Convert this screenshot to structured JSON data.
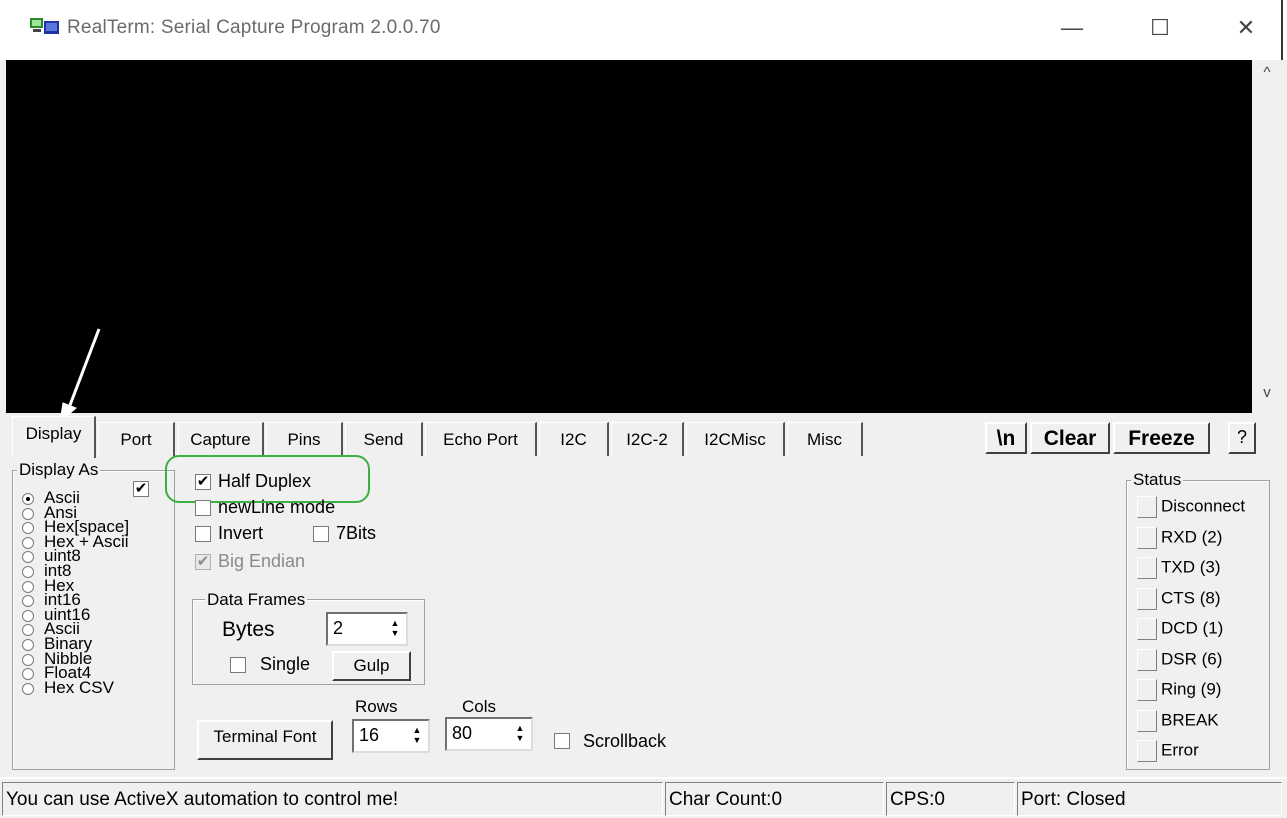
{
  "window": {
    "title": "RealTerm: Serial Capture Program 2.0.0.70",
    "minimize_glyph": "—",
    "maximize_glyph": "☐",
    "close_glyph": "✕"
  },
  "scroll": {
    "up_glyph": "^",
    "down_glyph": "v"
  },
  "tabs": [
    "Display",
    "Port",
    "Capture",
    "Pins",
    "Send",
    "Echo Port",
    "I2C",
    "I2C-2",
    "I2CMisc",
    "Misc"
  ],
  "active_tab": "Display",
  "toolbar": {
    "newline_label": "\\n",
    "clear_label": "Clear",
    "freeze_label": "Freeze",
    "help_label": "?"
  },
  "display_as": {
    "title": "Display As",
    "checkbox_checked": true,
    "options": [
      "Ascii",
      "Ansi",
      "Hex[space]",
      "Hex + Ascii",
      "uint8",
      "int8",
      "Hex",
      "int16",
      "uint16",
      "Ascii",
      "Binary",
      "Nibble",
      "Float4",
      "Hex CSV"
    ],
    "selected": "Ascii"
  },
  "options": {
    "half_duplex": {
      "label": "Half Duplex",
      "checked": true
    },
    "newline_mode": {
      "label": "newLine mode",
      "checked": false
    },
    "invert": {
      "label": "Invert",
      "checked": false
    },
    "seven_bits": {
      "label": "7Bits",
      "checked": false
    },
    "big_endian": {
      "label": "Big Endian",
      "checked": true,
      "disabled": true
    }
  },
  "data_frames": {
    "title": "Data Frames",
    "bytes_label": "Bytes",
    "bytes_value": "2",
    "single_label": "Single",
    "single_checked": false,
    "gulp_label": "Gulp"
  },
  "terminal": {
    "font_button": "Terminal Font",
    "rows_label": "Rows",
    "rows_value": "16",
    "cols_label": "Cols",
    "cols_value": "80",
    "scrollback_label": "Scrollback",
    "scrollback_checked": false
  },
  "status": {
    "title": "Status",
    "items": [
      "Disconnect",
      "RXD (2)",
      "TXD (3)",
      "CTS (8)",
      "DCD (1)",
      "DSR (6)",
      "Ring (9)",
      "BREAK",
      "Error"
    ]
  },
  "statusbar": {
    "message": "You can use ActiveX automation to control me!",
    "char_count": "Char Count:0",
    "cps": "CPS:0",
    "port": "Port: Closed"
  },
  "colors": {
    "highlight": "#3cb043",
    "terminal_bg": "#000000"
  }
}
